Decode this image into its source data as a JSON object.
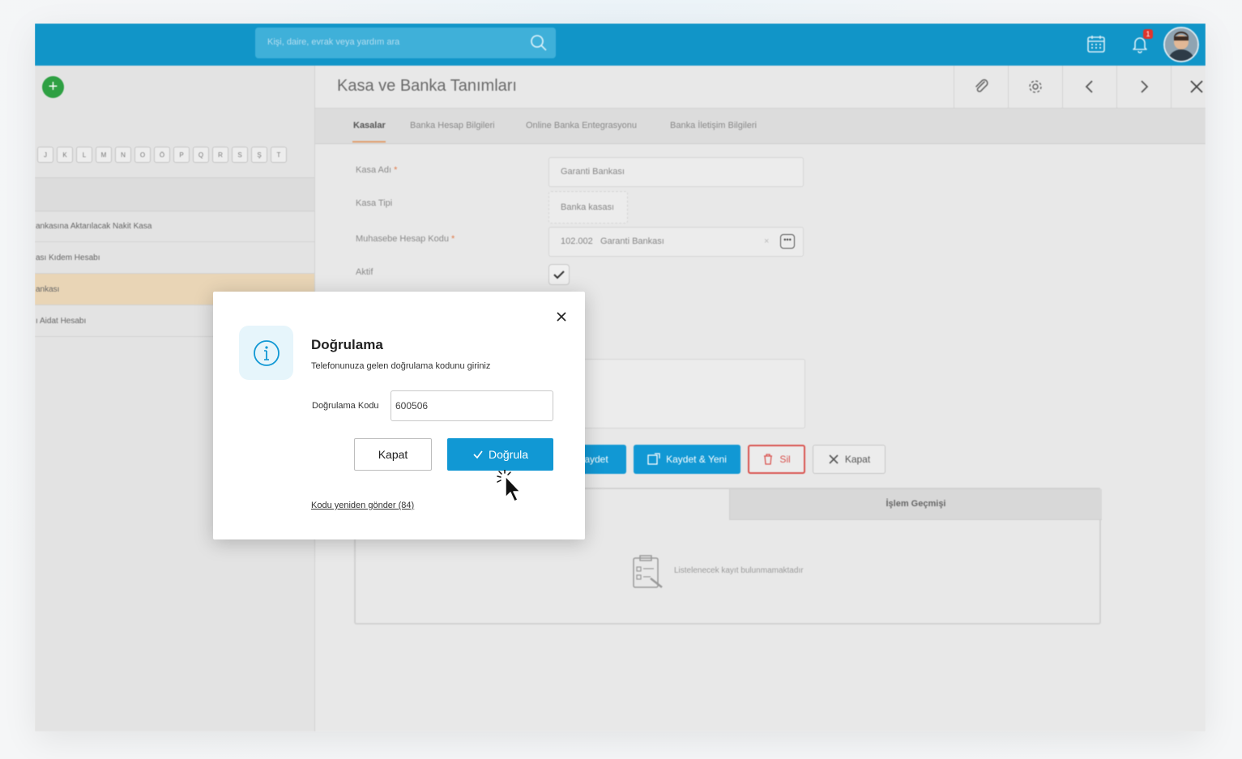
{
  "topbar": {
    "search_placeholder": "Kişi, daire, evrak veya yardım ara",
    "notification_count": "1",
    "colors": {
      "bar": "#1195c8",
      "search": "#3fb0d9"
    }
  },
  "left": {
    "letters": [
      "J",
      "K",
      "L",
      "M",
      "N",
      "O",
      "Ö",
      "P",
      "Q",
      "R",
      "S",
      "Ş",
      "T"
    ],
    "rows": [
      {
        "label": "ankasına Aktarılacak Nakit Kasa"
      },
      {
        "label": "ası Kıdem Hesabı"
      },
      {
        "label": "ankası",
        "selected": true
      },
      {
        "label": "ı Aidat Hesabı"
      }
    ]
  },
  "main": {
    "title": "Kasa ve Banka Tanımları",
    "tabs": [
      "Kasalar",
      "Banka Hesap Bilgileri",
      "Online Banka Entegrasyonu",
      "Banka İletişim Bilgileri"
    ],
    "active_tab": "Kasalar",
    "form": {
      "kasa_adi_label": "Kasa Adı",
      "kasa_adi_value": "Garanti Bankası",
      "kasa_tipi_label": "Kasa Tipi",
      "kasa_tipi_value": "Banka kasası",
      "muhasebe_label": "Muhasebe Hesap Kodu",
      "muhasebe_code": "102.002",
      "muhasebe_name": "Garanti Bankası",
      "aktif_label": "Aktif",
      "aktif_checked": true
    },
    "actions": {
      "kaydet": "aydet",
      "kaydet_yeni": "Kaydet & Yeni",
      "sil": "Sil",
      "kapat": "Kapat"
    },
    "history": {
      "tab_label": "İşlem Geçmişi",
      "empty_text": "Listelenecek kayıt bulunmamaktadır"
    }
  },
  "modal": {
    "title": "Doğrulama",
    "subtitle": "Telefonunuza gelen doğrulama kodunu giriniz",
    "code_label": "Doğrulama Kodu",
    "code_value": "600506",
    "close_label": "Kapat",
    "verify_label": "Doğrula",
    "resend_label": "Kodu yeniden gönder (84)",
    "colors": {
      "primary": "#1198d4",
      "info_bg": "#e6f5fb"
    }
  }
}
